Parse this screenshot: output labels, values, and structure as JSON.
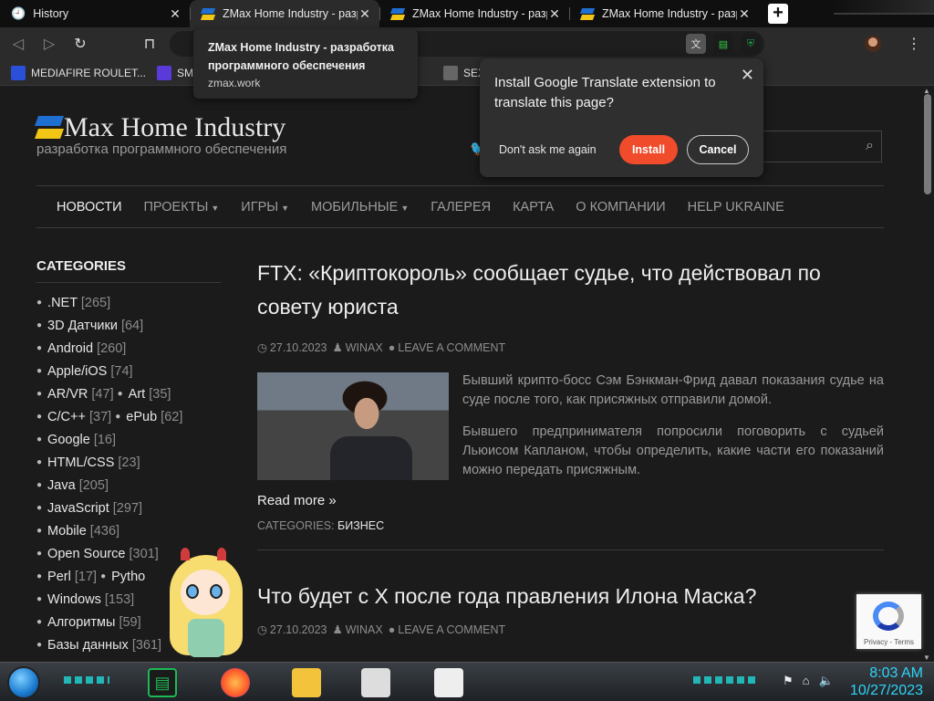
{
  "tabs": [
    {
      "title": "History",
      "icon": "history-icon",
      "active": false
    },
    {
      "title": "ZMax Home Industry - разработка",
      "icon": "zmax-icon",
      "active": true
    },
    {
      "title": "ZMax Home Industry - разработка",
      "icon": "zmax-icon",
      "active": false
    },
    {
      "title": "ZMax Home Industry - разработка",
      "icon": "zmax-icon",
      "active": false
    }
  ],
  "hover_card": {
    "title": "ZMax Home Industry - разработка программного обеспечения",
    "url": "zmax.work"
  },
  "bookmarks": [
    {
      "label": "MEDIAFIRE ROULET...",
      "color": "#2a4fd8"
    },
    {
      "label": "SM",
      "color": "#5a3ad8"
    },
    {
      "label": "SEX I",
      "color": "#666666"
    }
  ],
  "translate_popup": {
    "message": "Install Google Translate extension to translate this page?",
    "dont_ask": "Don't ask me again",
    "install": "Install",
    "cancel": "Cancel"
  },
  "site": {
    "logo": "Max Home Industry",
    "subtitle": "разработка программного обеспечения",
    "nav": [
      {
        "label": "НОВОСТИ",
        "active": true,
        "caret": false
      },
      {
        "label": "ПРОЕКТЫ",
        "active": false,
        "caret": true
      },
      {
        "label": "ИГРЫ",
        "active": false,
        "caret": true
      },
      {
        "label": "МОБИЛЬНЫЕ",
        "active": false,
        "caret": true
      },
      {
        "label": "ГАЛЕРЕЯ",
        "active": false,
        "caret": false
      },
      {
        "label": "КАРТА",
        "active": false,
        "caret": false
      },
      {
        "label": "О КОМПАНИИ",
        "active": false,
        "caret": false
      },
      {
        "label": "HELP UKRAINE",
        "active": false,
        "caret": false
      }
    ]
  },
  "sidebar": {
    "title": "CATEGORIES",
    "rows": [
      [
        {
          "name": ".NET",
          "count": "[265]"
        }
      ],
      [
        {
          "name": "3D Датчики",
          "count": "[64]"
        }
      ],
      [
        {
          "name": "Android",
          "count": "[260]"
        }
      ],
      [
        {
          "name": "Apple/iOS",
          "count": "[74]"
        }
      ],
      [
        {
          "name": "AR/VR",
          "count": "[47]"
        },
        {
          "name": "Art",
          "count": "[35]"
        }
      ],
      [
        {
          "name": "C/C++",
          "count": "[37]"
        },
        {
          "name": "ePub",
          "count": "[62]"
        }
      ],
      [
        {
          "name": "Google",
          "count": "[16]"
        }
      ],
      [
        {
          "name": "HTML/CSS",
          "count": "[23]"
        }
      ],
      [
        {
          "name": "Java",
          "count": "[205]"
        }
      ],
      [
        {
          "name": "JavaScript",
          "count": "[297]"
        }
      ],
      [
        {
          "name": "Mobile",
          "count": "[436]"
        }
      ],
      [
        {
          "name": "Open Source",
          "count": "[301]"
        }
      ],
      [
        {
          "name": "Perl",
          "count": "[17]"
        },
        {
          "name": "Pytho",
          "count": ""
        }
      ],
      [
        {
          "name": "Windows",
          "count": "[153]"
        }
      ],
      [
        {
          "name": "Алгоритмы",
          "count": "[59]"
        }
      ],
      [
        {
          "name": "Базы данных",
          "count": "[361]"
        }
      ]
    ]
  },
  "articles": [
    {
      "title": "FTX: «Криптокороль» сообщает судье, что действовал по совету юриста",
      "date": "27.10.2023",
      "author": "WINAX",
      "comment": "LEAVE A COMMENT",
      "p1": "Бывший крипто-босс Сэм Бэнкман-Фрид давал показания судье на суде после того, как присяжных отправили домой.",
      "p2": "Бывшего предпринимателя попросили поговорить с судьей Льюисом Капланом, чтобы определить, какие части его показаний можно передать присяжным.",
      "read_more": "Read more »",
      "categories_label": "CATEGORIES:",
      "category": "БИЗНЕС"
    },
    {
      "title": "Что будет с X после года правления Илона Маска?",
      "date": "27.10.2023",
      "author": "WINAX",
      "comment": "LEAVE A COMMENT"
    }
  ],
  "recaptcha": {
    "text": "Privacy - Terms"
  },
  "taskbar": {
    "icons": [
      "spotify-icon",
      "firefox-icon",
      "file-explorer-icon",
      "app-icon-1",
      "app-icon-2"
    ],
    "clock_time": "8:03 AM",
    "clock_date": "10/27/2023"
  }
}
